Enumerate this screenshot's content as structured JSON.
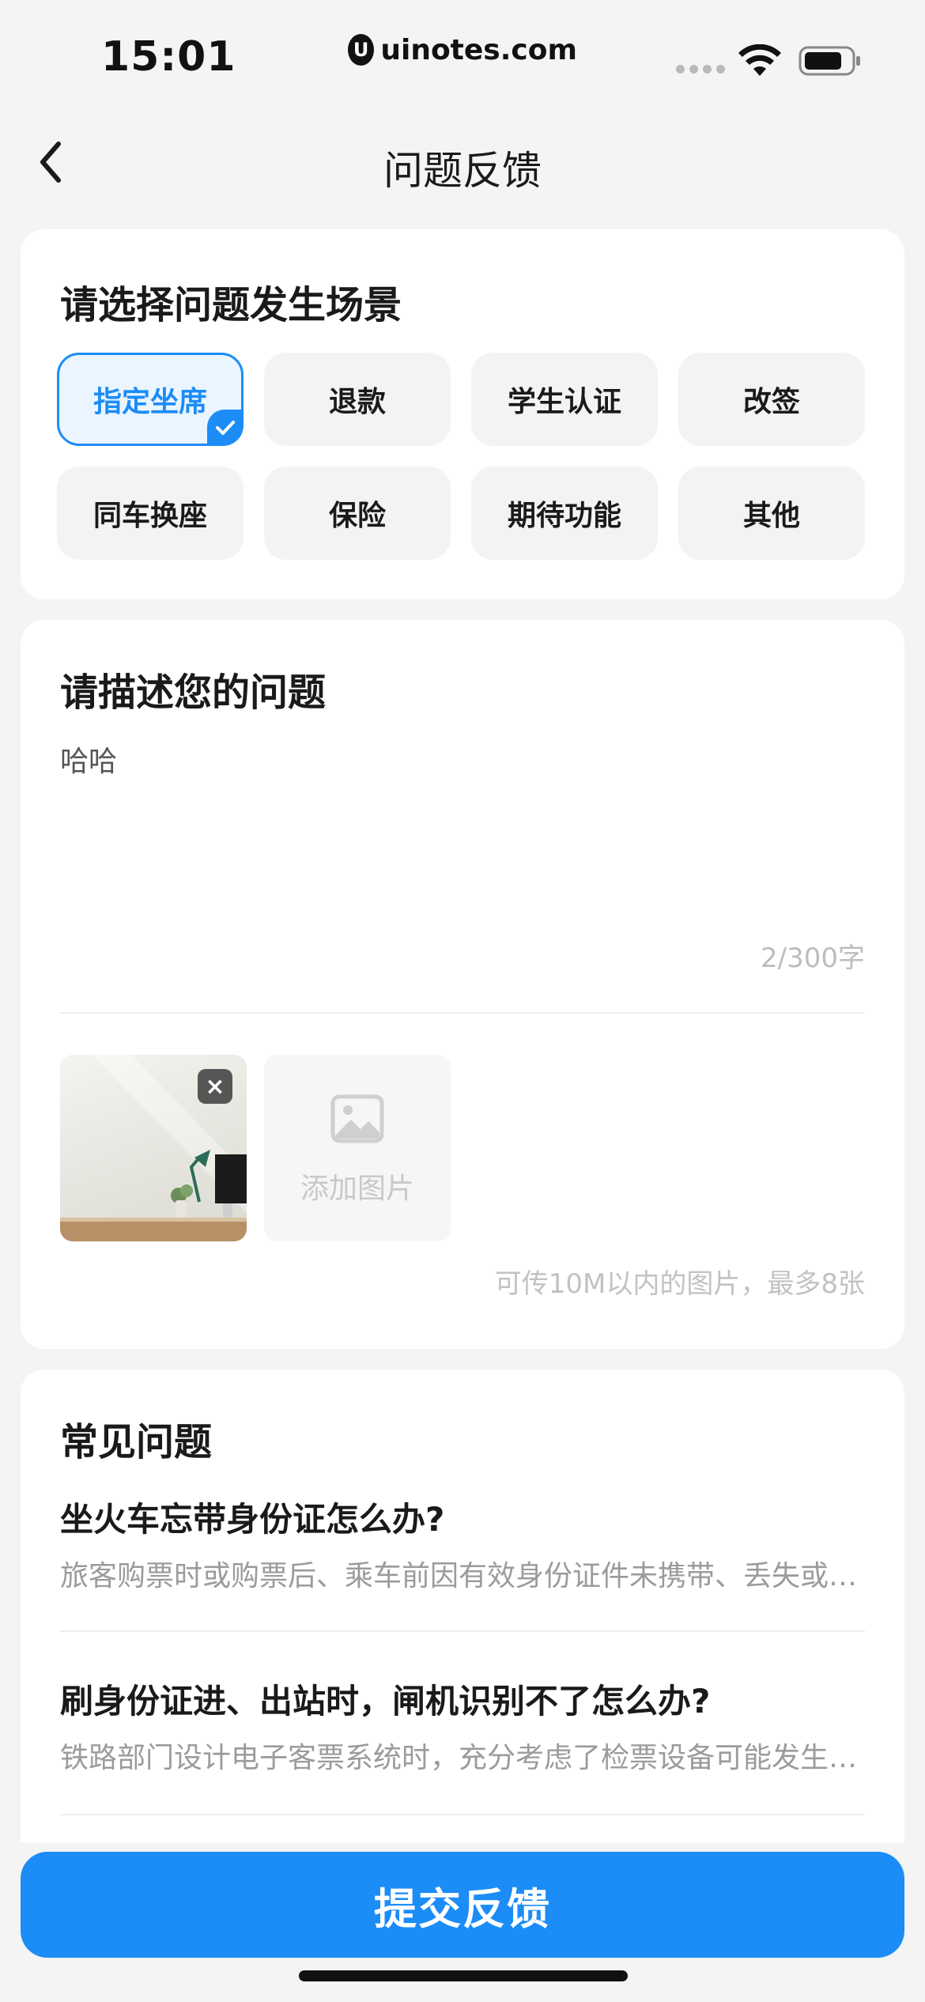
{
  "status_bar": {
    "time": "15:01",
    "site_logo_letter": "U",
    "site": "uinotes.com"
  },
  "nav": {
    "title": "问题反馈"
  },
  "scene_section": {
    "title": "请选择问题发生场景",
    "chips": [
      {
        "label": "指定坐席",
        "selected": true
      },
      {
        "label": "退款",
        "selected": false
      },
      {
        "label": "学生认证",
        "selected": false
      },
      {
        "label": "改签",
        "selected": false
      },
      {
        "label": "同车换座",
        "selected": false
      },
      {
        "label": "保险",
        "selected": false
      },
      {
        "label": "期待功能",
        "selected": false
      },
      {
        "label": "其他",
        "selected": false
      }
    ]
  },
  "describe_section": {
    "title": "请描述您的问题",
    "value": "哈哈",
    "counter": "2/300字",
    "add_image_label": "添加图片",
    "close_glyph": "×",
    "upload_hint": "可传10M以内的图片，最多8张"
  },
  "faq_section": {
    "title": "常见问题",
    "items": [
      {
        "question": "坐火车忘带身份证怎么办?",
        "answer": "旅客购票时或购票后、乘车前因有效身份证件未携带、丢失或被盗等情况"
      },
      {
        "question": "刷身份证进、出站时，闸机识别不了怎么办?",
        "answer": "铁路部门设计电子客票系统时，充分考虑了检票设备可能发生故障等情况"
      }
    ]
  },
  "submit": {
    "label": "提交反馈"
  },
  "colors": {
    "accent": "#1c8cf7",
    "background": "#f4f4f4",
    "card": "#ffffff"
  }
}
